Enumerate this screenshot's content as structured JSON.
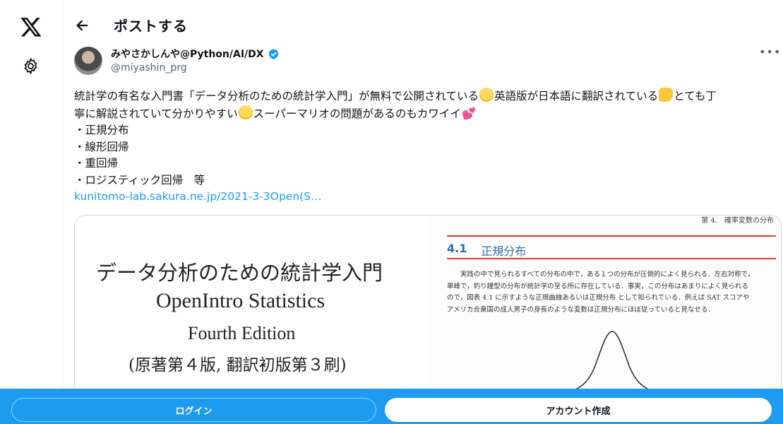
{
  "header": {
    "title": "ポストする",
    "back_icon": "arrow-left-icon"
  },
  "rail": {
    "logo_icon": "x-logo-icon",
    "settings_icon": "gear-icon"
  },
  "author": {
    "display_name": "みやさかしんや@Python/AI/DX",
    "handle": "@miyashin_prg",
    "verified": true,
    "verified_color": "#1d9bf0"
  },
  "post": {
    "line1_a": "統計学の有名な入門書「データ分析のための統計学入門」が無料で公開されている",
    "line1_b": "英語版が日本語に翻訳されている",
    "line1_c": "とても丁",
    "line2_a": "寧に解説されていて分かりやすい",
    "line2_b": "スーパーマリオの問題があるのもカワイイ",
    "emoji_hug": "hugging-face-emoji",
    "emoji_thumb": "thumbs-up-emoji",
    "emoji_heart": "💕",
    "bullets": [
      "・正規分布",
      "・線形回帰",
      "・重回帰",
      "・ロジスティック回帰　等"
    ],
    "link": "kunitomo-lab.sakura.ne.jp/2021-3-3Open(S…",
    "link_color": "#1d9bf0"
  },
  "media": {
    "book_title_jp": "データ分析のための統計学入門",
    "book_title_en": "OpenIntro Statistics",
    "book_edition": "Fourth Edition",
    "book_print": "(原著第４版, 翻訳初版第３刷)",
    "chapter_header": "第 4.　確率変数の分布",
    "section_number": "4.1",
    "section_title": "正規分布",
    "section_lines": [
      "　　実践の中で見られるすべての分布の中で，ある１つの分布が圧倒的によく見られる．左右対称で，",
      "単峰で，釣り鐘型の分布が統計学の至る所に存在している．事実，この分布はあまりによく見られる",
      "ので，図表 4.1 に示すような正規曲線あるいは正規分布 として知られている．例えば SAT スコアや",
      "アメリカ合衆国の成人男子の身長のような変数は正規分布にほぼ従っていると見なせる．"
    ]
  },
  "bottom_bar": {
    "login": "ログイン",
    "signup": "アカウント作成",
    "bar_color": "#1d9bf0"
  },
  "more_icon": "more-dots-icon"
}
